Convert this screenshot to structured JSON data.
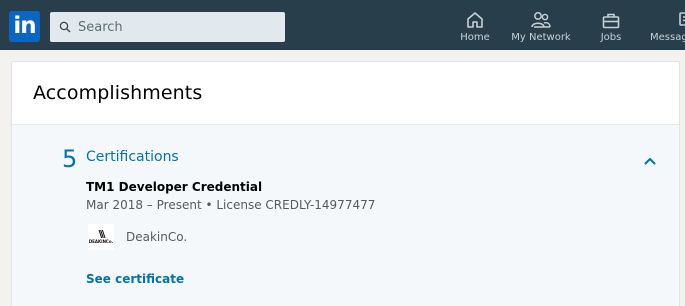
{
  "nav": {
    "logo_text": "in",
    "search": {
      "placeholder": "Search",
      "icon": "search-icon"
    },
    "items": [
      {
        "label": "Home",
        "icon": "home-icon"
      },
      {
        "label": "My Network",
        "icon": "network-icon"
      },
      {
        "label": "Jobs",
        "icon": "briefcase-icon"
      },
      {
        "label": "Messag",
        "icon": "messaging-icon"
      }
    ],
    "colors": {
      "bar": "#283e4a",
      "brand": "#0a66c2",
      "icon": "#c7d1d8"
    }
  },
  "card": {
    "title": "Accomplishments",
    "section": {
      "count": "5",
      "title": "Certifications",
      "collapse_icon": "chevron-up-icon",
      "certificate": {
        "name": "TM1 Developer Credential",
        "meta": "Mar 2018 – Present  • License CREDLY-14977477",
        "issuer_logo_text": "DEAKINCo.",
        "issuer_name": "DeakinCo.",
        "link_label": "See certificate"
      }
    },
    "colors": {
      "accent": "#0073b1",
      "body_bg": "#f5f8fa"
    }
  }
}
